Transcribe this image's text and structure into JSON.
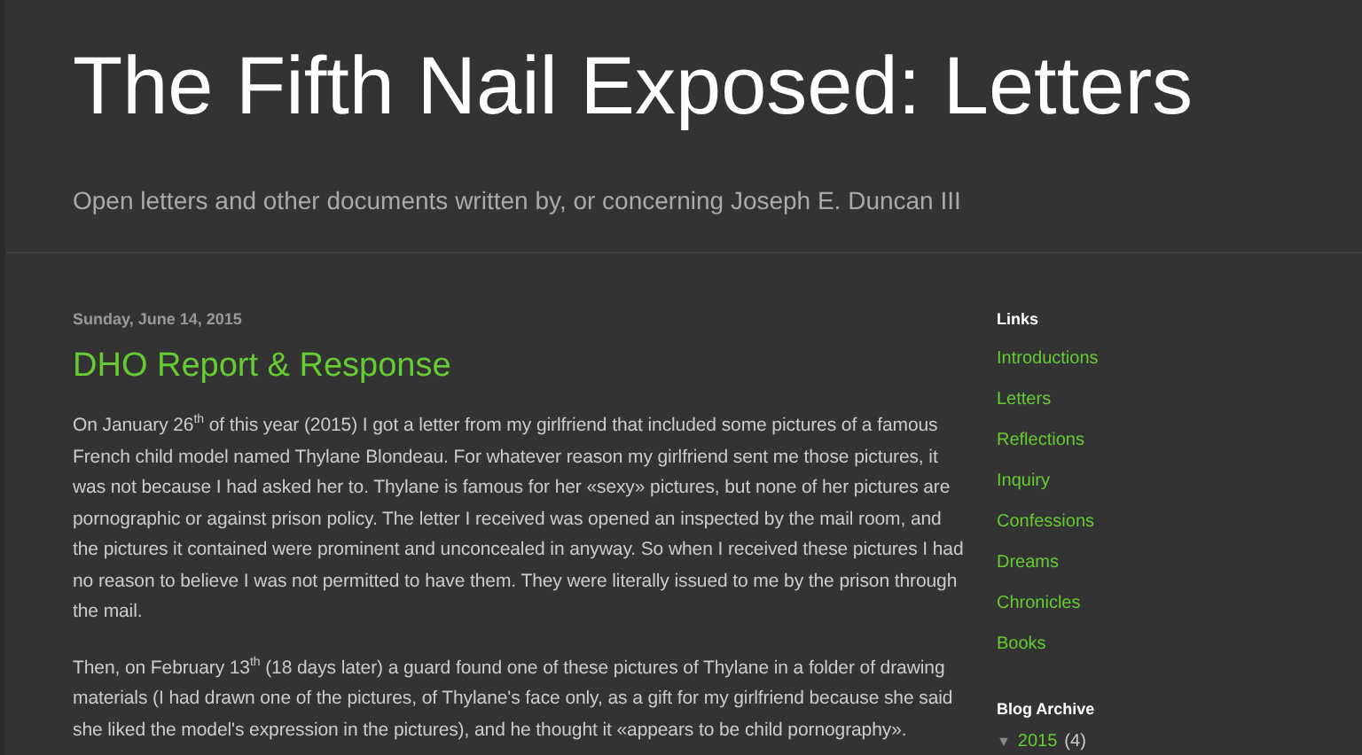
{
  "header": {
    "title": "The Fifth Nail Exposed: Letters",
    "description": "Open letters and other documents written by, or concerning Joseph E. Duncan III"
  },
  "post": {
    "date": "Sunday, June 14, 2015",
    "title": "DHO Report & Response",
    "paragraphs": [
      "On January 26$^{th}$ of this year (2015) I got a letter from my girlfriend that included some pictures of a famous French child model named Thylane Blondeau. For whatever reason my girlfriend sent me those pictures, it was not because I had asked her to. Thylane is famous for her «sexy» pictures, but none of her pictures are pornographic or against prison policy. The letter I received was opened an inspected by the mail room, and the pictures it contained were prominent and unconcealed in anyway. So when I received these pictures I had no reason to believe I was not permitted to have them. They were literally issued to me by the prison through the mail.",
      "Then, on February 13$^{th}$ (18 days later) a guard found one of these pictures of Thylane in a folder of drawing materials (I had drawn one of the pictures, of Thylane's face only, as a gift for my girlfriend because she said she liked the model's expression in the pictures), and he thought it «appears to be child pornography»."
    ]
  },
  "sidebar": {
    "links_title": "Links",
    "links": [
      "Introductions",
      "Letters",
      "Reflections",
      "Inquiry",
      "Confessions",
      "Dreams",
      "Chronicles",
      "Books"
    ],
    "archive_title": "Blog Archive",
    "archive": [
      {
        "toggle": "▼",
        "year": "2015",
        "count": "(4)",
        "expanded": true
      }
    ]
  }
}
